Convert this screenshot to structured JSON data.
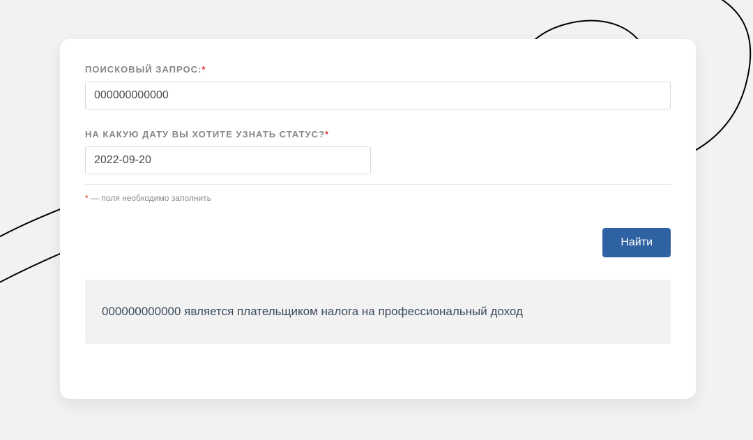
{
  "form": {
    "search": {
      "label": "ПОИСКОВЫЙ ЗАПРОС:",
      "required_mark": "*",
      "value": "000000000000"
    },
    "date": {
      "label": "НА КАКУЮ ДАТУ ВЫ ХОТИТЕ УЗНАТЬ СТАТУС?",
      "required_mark": "*",
      "value": "2022-09-20"
    },
    "hint": {
      "mark": "*",
      "text": " — поля необходимо заполнить"
    },
    "submit_label": "Найти"
  },
  "result": {
    "text": "000000000000 является плательщиком налога на профессиональный доход"
  }
}
